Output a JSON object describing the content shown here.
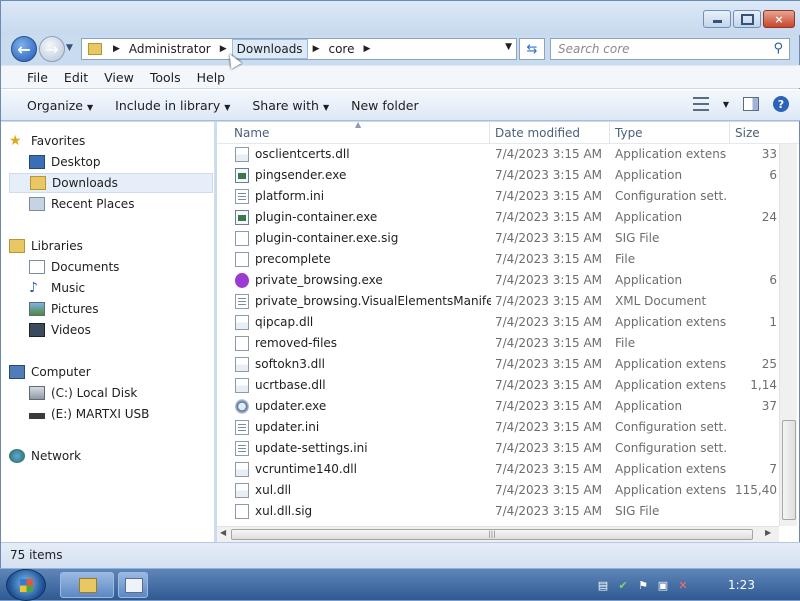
{
  "window": {
    "controls": {
      "minimize": "minimize",
      "maximize": "maximize",
      "close": "×"
    }
  },
  "address": {
    "crumbs": [
      "Administrator",
      "Downloads",
      "core"
    ]
  },
  "search": {
    "placeholder": "Search core"
  },
  "menu": [
    "File",
    "Edit",
    "View",
    "Tools",
    "Help"
  ],
  "commands": {
    "organize": "Organize",
    "include": "Include in library",
    "share": "Share with",
    "newfolder": "New folder"
  },
  "nav": {
    "favorites": "Favorites",
    "desktop": "Desktop",
    "downloads": "Downloads",
    "recent": "Recent Places",
    "libraries": "Libraries",
    "documents": "Documents",
    "music": "Music",
    "pictures": "Pictures",
    "videos": "Videos",
    "computer": "Computer",
    "cdisk": "(C:) Local Disk",
    "edisk": "(E:) MARTXI USB",
    "network": "Network"
  },
  "columns": {
    "name": "Name",
    "date": "Date modified",
    "type": "Type",
    "size": "Size"
  },
  "files": [
    {
      "name": "osclientcerts.dll",
      "date": "7/4/2023 3:15 AM",
      "type": "Application extens...",
      "size": "33",
      "icon": "dll"
    },
    {
      "name": "pingsender.exe",
      "date": "7/4/2023 3:15 AM",
      "type": "Application",
      "size": "6",
      "icon": "exe"
    },
    {
      "name": "platform.ini",
      "date": "7/4/2023 3:15 AM",
      "type": "Configuration sett...",
      "size": "",
      "icon": "ini"
    },
    {
      "name": "plugin-container.exe",
      "date": "7/4/2023 3:15 AM",
      "type": "Application",
      "size": "24",
      "icon": "exe"
    },
    {
      "name": "plugin-container.exe.sig",
      "date": "7/4/2023 3:15 AM",
      "type": "SIG File",
      "size": "",
      "icon": "blank"
    },
    {
      "name": "precomplete",
      "date": "7/4/2023 3:15 AM",
      "type": "File",
      "size": "",
      "icon": "blank"
    },
    {
      "name": "private_browsing.exe",
      "date": "7/4/2023 3:15 AM",
      "type": "Application",
      "size": "6",
      "icon": "purple"
    },
    {
      "name": "private_browsing.VisualElementsManifes...",
      "date": "7/4/2023 3:15 AM",
      "type": "XML Document",
      "size": "",
      "icon": "ini"
    },
    {
      "name": "qipcap.dll",
      "date": "7/4/2023 3:15 AM",
      "type": "Application extens...",
      "size": "1",
      "icon": "dll"
    },
    {
      "name": "removed-files",
      "date": "7/4/2023 3:15 AM",
      "type": "File",
      "size": "",
      "icon": "blank"
    },
    {
      "name": "softokn3.dll",
      "date": "7/4/2023 3:15 AM",
      "type": "Application extens...",
      "size": "25",
      "icon": "dll"
    },
    {
      "name": "ucrtbase.dll",
      "date": "7/4/2023 3:15 AM",
      "type": "Application extens...",
      "size": "1,14",
      "icon": "dll"
    },
    {
      "name": "updater.exe",
      "date": "7/4/2023 3:15 AM",
      "type": "Application",
      "size": "37",
      "icon": "updater"
    },
    {
      "name": "updater.ini",
      "date": "7/4/2023 3:15 AM",
      "type": "Configuration sett...",
      "size": "",
      "icon": "ini"
    },
    {
      "name": "update-settings.ini",
      "date": "7/4/2023 3:15 AM",
      "type": "Configuration sett...",
      "size": "",
      "icon": "ini"
    },
    {
      "name": "vcruntime140.dll",
      "date": "7/4/2023 3:15 AM",
      "type": "Application extens...",
      "size": "7",
      "icon": "dll"
    },
    {
      "name": "xul.dll",
      "date": "7/4/2023 3:15 AM",
      "type": "Application extens...",
      "size": "115,40",
      "icon": "dll"
    },
    {
      "name": "xul.dll.sig",
      "date": "7/4/2023 3:15 AM",
      "type": "SIG File",
      "size": "",
      "icon": "blank"
    }
  ],
  "status": {
    "count": "75 items"
  },
  "taskbar": {
    "clock": "1:23"
  },
  "colors": {
    "accent": "#2b5797",
    "selection": "#e6eef9",
    "secondary_text": "#6d6d6d"
  }
}
